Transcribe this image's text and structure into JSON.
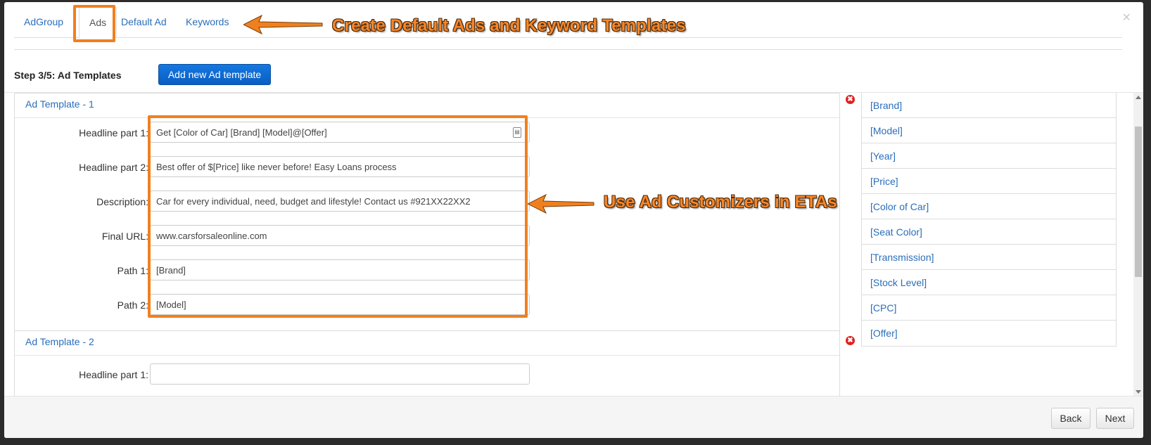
{
  "tabs": [
    {
      "label": "AdGroup"
    },
    {
      "label": "Ads"
    },
    {
      "label": "Default Ad"
    },
    {
      "label": "Keywords"
    }
  ],
  "annotations": {
    "tabs_note": "Create Default Ads and Keyword Templates",
    "form_note": "Use Ad Customizers in ETAs"
  },
  "step_title": "Step 3/5: Ad Templates",
  "add_button": "Add new Ad template",
  "templates": [
    {
      "title": "Ad Template - 1",
      "fields": [
        {
          "label": "Headline part 1:",
          "value": "Get [Color of Car] [Brand] [Model]@[Offer]"
        },
        {
          "label": "Headline part 2:",
          "value": "Best offer of $[Price] like never before! Easy Loans process"
        },
        {
          "label": "Description:",
          "value": "Car for every individual, need, budget and lifestyle! Contact us #921XX22XX2"
        },
        {
          "label": "Final URL:",
          "value": "www.carsforsaleonline.com"
        },
        {
          "label": "Path 1:",
          "value": "[Brand]"
        },
        {
          "label": "Path 2:",
          "value": "[Model]"
        }
      ]
    },
    {
      "title": "Ad Template - 2",
      "fields": [
        {
          "label": "Headline part 1:",
          "value": ""
        }
      ]
    }
  ],
  "customizers": [
    "[Brand]",
    "[Model]",
    "[Year]",
    "[Price]",
    "[Color of Car]",
    "[Seat Color]",
    "[Transmission]",
    "[Stock Level]",
    "[CPC]",
    "[Offer]"
  ],
  "footer": {
    "back": "Back",
    "next": "Next"
  },
  "close_symbol": "×",
  "delete_symbol": "✖",
  "colors": {
    "accent": "#f0801f",
    "link": "#2a6ebb",
    "primary_button": "#0a5ec4"
  }
}
